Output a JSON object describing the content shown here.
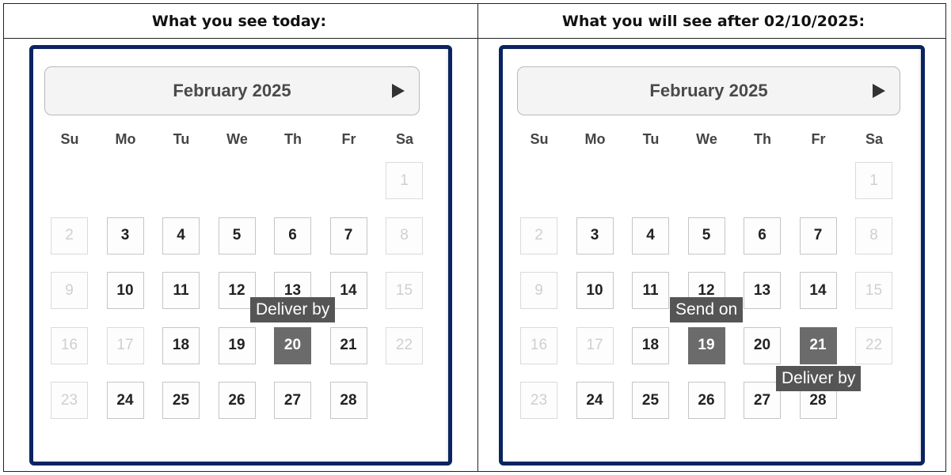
{
  "panels": [
    {
      "header": "What you see today:",
      "month": "February 2025",
      "days_of_week": [
        "Su",
        "Mo",
        "Tu",
        "We",
        "Th",
        "Fr",
        "Sa"
      ],
      "weeks": [
        [
          null,
          null,
          null,
          null,
          null,
          null,
          {
            "d": "1",
            "s": "disabled"
          }
        ],
        [
          {
            "d": "2",
            "s": "disabled"
          },
          {
            "d": "3",
            "s": "enabled"
          },
          {
            "d": "4",
            "s": "enabled"
          },
          {
            "d": "5",
            "s": "enabled"
          },
          {
            "d": "6",
            "s": "enabled"
          },
          {
            "d": "7",
            "s": "enabled"
          },
          {
            "d": "8",
            "s": "disabled"
          }
        ],
        [
          {
            "d": "9",
            "s": "disabled"
          },
          {
            "d": "10",
            "s": "enabled"
          },
          {
            "d": "11",
            "s": "enabled"
          },
          {
            "d": "12",
            "s": "enabled"
          },
          {
            "d": "13",
            "s": "enabled"
          },
          {
            "d": "14",
            "s": "enabled"
          },
          {
            "d": "15",
            "s": "disabled"
          }
        ],
        [
          {
            "d": "16",
            "s": "disabled"
          },
          {
            "d": "17",
            "s": "disabled"
          },
          {
            "d": "18",
            "s": "enabled"
          },
          {
            "d": "19",
            "s": "enabled"
          },
          {
            "d": "20",
            "s": "selected"
          },
          {
            "d": "21",
            "s": "enabled"
          },
          {
            "d": "22",
            "s": "disabled"
          }
        ],
        [
          {
            "d": "23",
            "s": "disabled"
          },
          {
            "d": "24",
            "s": "enabled"
          },
          {
            "d": "25",
            "s": "enabled"
          },
          {
            "d": "26",
            "s": "enabled"
          },
          {
            "d": "27",
            "s": "enabled"
          },
          {
            "d": "28",
            "s": "enabled"
          },
          null
        ]
      ],
      "tooltips": [
        {
          "text": "Deliver by",
          "anchor": "above",
          "date": "20"
        }
      ]
    },
    {
      "header": "What you will see after 02/10/2025:",
      "month": "February 2025",
      "days_of_week": [
        "Su",
        "Mo",
        "Tu",
        "We",
        "Th",
        "Fr",
        "Sa"
      ],
      "weeks": [
        [
          null,
          null,
          null,
          null,
          null,
          null,
          {
            "d": "1",
            "s": "disabled"
          }
        ],
        [
          {
            "d": "2",
            "s": "disabled"
          },
          {
            "d": "3",
            "s": "enabled"
          },
          {
            "d": "4",
            "s": "enabled"
          },
          {
            "d": "5",
            "s": "enabled"
          },
          {
            "d": "6",
            "s": "enabled"
          },
          {
            "d": "7",
            "s": "enabled"
          },
          {
            "d": "8",
            "s": "disabled"
          }
        ],
        [
          {
            "d": "9",
            "s": "disabled"
          },
          {
            "d": "10",
            "s": "enabled"
          },
          {
            "d": "11",
            "s": "enabled"
          },
          {
            "d": "12",
            "s": "enabled"
          },
          {
            "d": "13",
            "s": "enabled"
          },
          {
            "d": "14",
            "s": "enabled"
          },
          {
            "d": "15",
            "s": "disabled"
          }
        ],
        [
          {
            "d": "16",
            "s": "disabled"
          },
          {
            "d": "17",
            "s": "disabled"
          },
          {
            "d": "18",
            "s": "enabled"
          },
          {
            "d": "19",
            "s": "selected"
          },
          {
            "d": "20",
            "s": "enabled"
          },
          {
            "d": "21",
            "s": "selected"
          },
          {
            "d": "22",
            "s": "disabled"
          }
        ],
        [
          {
            "d": "23",
            "s": "disabled"
          },
          {
            "d": "24",
            "s": "enabled"
          },
          {
            "d": "25",
            "s": "enabled"
          },
          {
            "d": "26",
            "s": "enabled"
          },
          {
            "d": "27",
            "s": "enabled"
          },
          {
            "d": "28",
            "s": "enabled"
          },
          null
        ]
      ],
      "tooltips": [
        {
          "text": "Send on",
          "anchor": "above",
          "date": "19"
        },
        {
          "text": "Deliver by",
          "anchor": "below",
          "date": "21"
        }
      ]
    }
  ],
  "colors": {
    "frame": "#0b2460",
    "selected_day": "#6b6b6b",
    "tooltip": "#555555"
  },
  "icons": {
    "next_month": "right-triangle-arrow-icon"
  }
}
